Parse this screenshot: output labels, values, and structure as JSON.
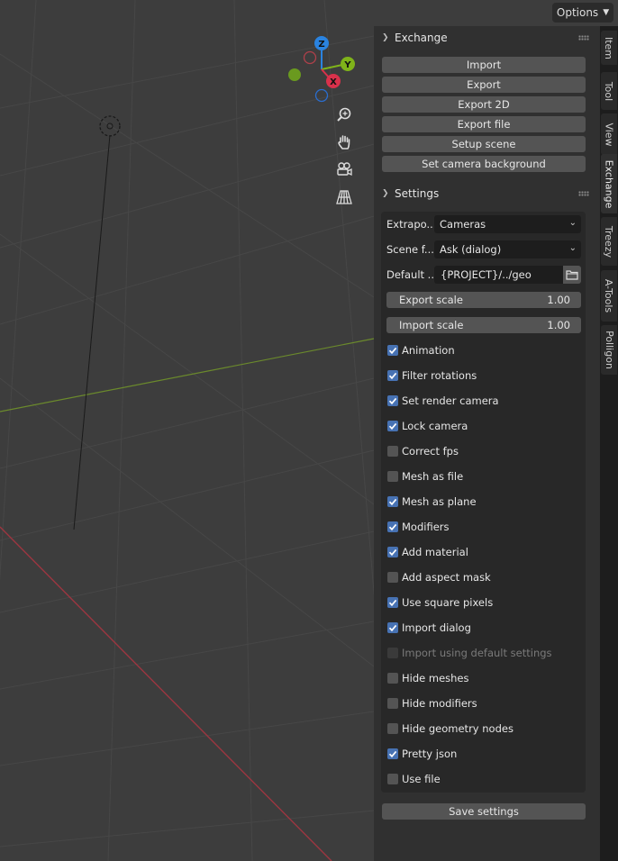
{
  "header": {
    "options_label": "Options"
  },
  "gizmo": {
    "z": "Z",
    "y": "Y",
    "x": "X"
  },
  "colors": {
    "accent": "#4772b3",
    "x_axis": "#d9314b",
    "y_axis": "#7fb31a",
    "z_axis": "#2a83e0",
    "grid_x_line": "#9c3640",
    "grid_y_line": "#6b8a2c"
  },
  "exchange": {
    "title": "Exchange",
    "buttons": [
      "Import",
      "Export",
      "Export 2D",
      "Export file",
      "Setup scene",
      "Set camera background"
    ]
  },
  "settings": {
    "title": "Settings",
    "extrapolate_label": "Extrapo...",
    "extrapolate_value": "Cameras",
    "scene_label": "Scene f...",
    "scene_value": "Ask (dialog)",
    "default_label": "Default ...",
    "default_value": "{PROJECT}/../geo",
    "export_scale_label": "Export scale",
    "export_scale_value": "1.00",
    "import_scale_label": "Import scale",
    "import_scale_value": "1.00",
    "checkboxes": [
      {
        "label": "Animation",
        "checked": true
      },
      {
        "label": "Filter rotations",
        "checked": true
      },
      {
        "label": "Set render camera",
        "checked": true
      },
      {
        "label": "Lock camera",
        "checked": true
      },
      {
        "label": "Correct fps",
        "checked": false
      },
      {
        "label": "Mesh as file",
        "checked": false
      },
      {
        "label": "Mesh as plane",
        "checked": true
      },
      {
        "label": "Modifiers",
        "checked": true
      },
      {
        "label": "Add material",
        "checked": true
      },
      {
        "label": "Add aspect mask",
        "checked": false
      },
      {
        "label": "Use square pixels",
        "checked": true
      },
      {
        "label": "Import dialog",
        "checked": true
      },
      {
        "label": "Import using default settings",
        "checked": false,
        "disabled": true
      },
      {
        "label": "Hide meshes",
        "checked": false
      },
      {
        "label": "Hide modifiers",
        "checked": false
      },
      {
        "label": "Hide geometry nodes",
        "checked": false
      },
      {
        "label": "Pretty json",
        "checked": true
      },
      {
        "label": "Use file",
        "checked": false
      }
    ],
    "save_label": "Save settings"
  },
  "tabs": [
    "Item",
    "Tool",
    "View",
    "Exchange",
    "Treezy",
    "A-Tools",
    "Polligon"
  ],
  "active_tab": "Exchange"
}
